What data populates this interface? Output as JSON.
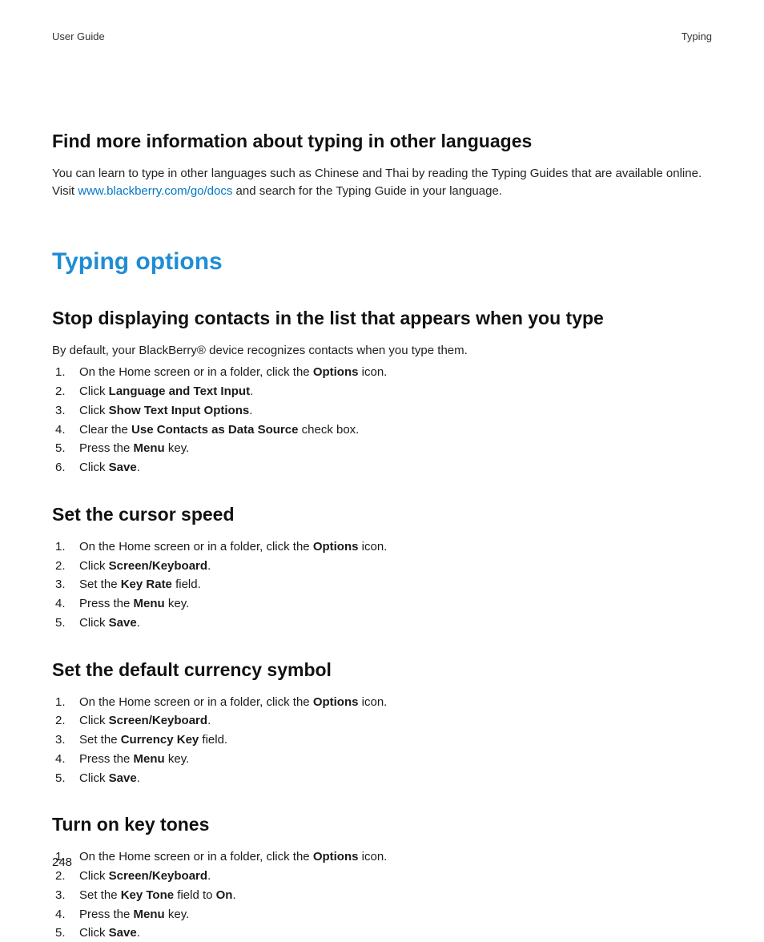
{
  "header": {
    "left": "User Guide",
    "right": "Typing"
  },
  "page_number": "248",
  "s1": {
    "heading": "Find more information about typing in other languages",
    "p_pre": "You can learn to type in other languages such as Chinese and Thai by reading the Typing Guides that are available online. Visit ",
    "link": "www.blackberry.com/go/docs",
    "p_post": " and search for the Typing Guide in your language."
  },
  "h1": "Typing options",
  "s2": {
    "heading": "Stop displaying contacts in the list that appears when you type",
    "intro": "By default, your BlackBerry® device recognizes contacts when you type them.",
    "steps": [
      {
        "pre": "On the Home screen or in a folder, click the ",
        "b": "Options",
        "post": " icon."
      },
      {
        "pre": "Click ",
        "b": "Language and Text Input",
        "post": "."
      },
      {
        "pre": "Click ",
        "b": "Show Text Input Options",
        "post": "."
      },
      {
        "pre": "Clear the ",
        "b": "Use Contacts as Data Source",
        "post": " check box."
      },
      {
        "pre": "Press the ",
        "b": "Menu",
        "post": " key."
      },
      {
        "pre": "Click ",
        "b": "Save",
        "post": "."
      }
    ]
  },
  "s3": {
    "heading": "Set the cursor speed",
    "steps": [
      {
        "pre": "On the Home screen or in a folder, click the ",
        "b": "Options",
        "post": " icon."
      },
      {
        "pre": "Click ",
        "b": "Screen/Keyboard",
        "post": "."
      },
      {
        "pre": "Set the ",
        "b": "Key Rate",
        "post": " field."
      },
      {
        "pre": "Press the ",
        "b": "Menu",
        "post": " key."
      },
      {
        "pre": "Click ",
        "b": "Save",
        "post": "."
      }
    ]
  },
  "s4": {
    "heading": "Set the default currency symbol",
    "steps": [
      {
        "pre": "On the Home screen or in a folder, click the ",
        "b": "Options",
        "post": " icon."
      },
      {
        "pre": "Click ",
        "b": "Screen/Keyboard",
        "post": "."
      },
      {
        "pre": "Set the ",
        "b": "Currency Key",
        "post": " field."
      },
      {
        "pre": "Press the ",
        "b": "Menu",
        "post": " key."
      },
      {
        "pre": "Click ",
        "b": "Save",
        "post": "."
      }
    ]
  },
  "s5": {
    "heading": "Turn on key tones",
    "steps": [
      {
        "pre": "On the Home screen or in a folder, click the ",
        "b": "Options",
        "post": " icon."
      },
      {
        "pre": "Click ",
        "b": "Screen/Keyboard",
        "post": "."
      },
      {
        "pre": "Set the ",
        "b": "Key Tone",
        "b2": "On",
        "mid": " field to ",
        "post": "."
      },
      {
        "pre": "Press the ",
        "b": "Menu",
        "post": " key."
      },
      {
        "pre": "Click ",
        "b": "Save",
        "post": "."
      }
    ]
  }
}
